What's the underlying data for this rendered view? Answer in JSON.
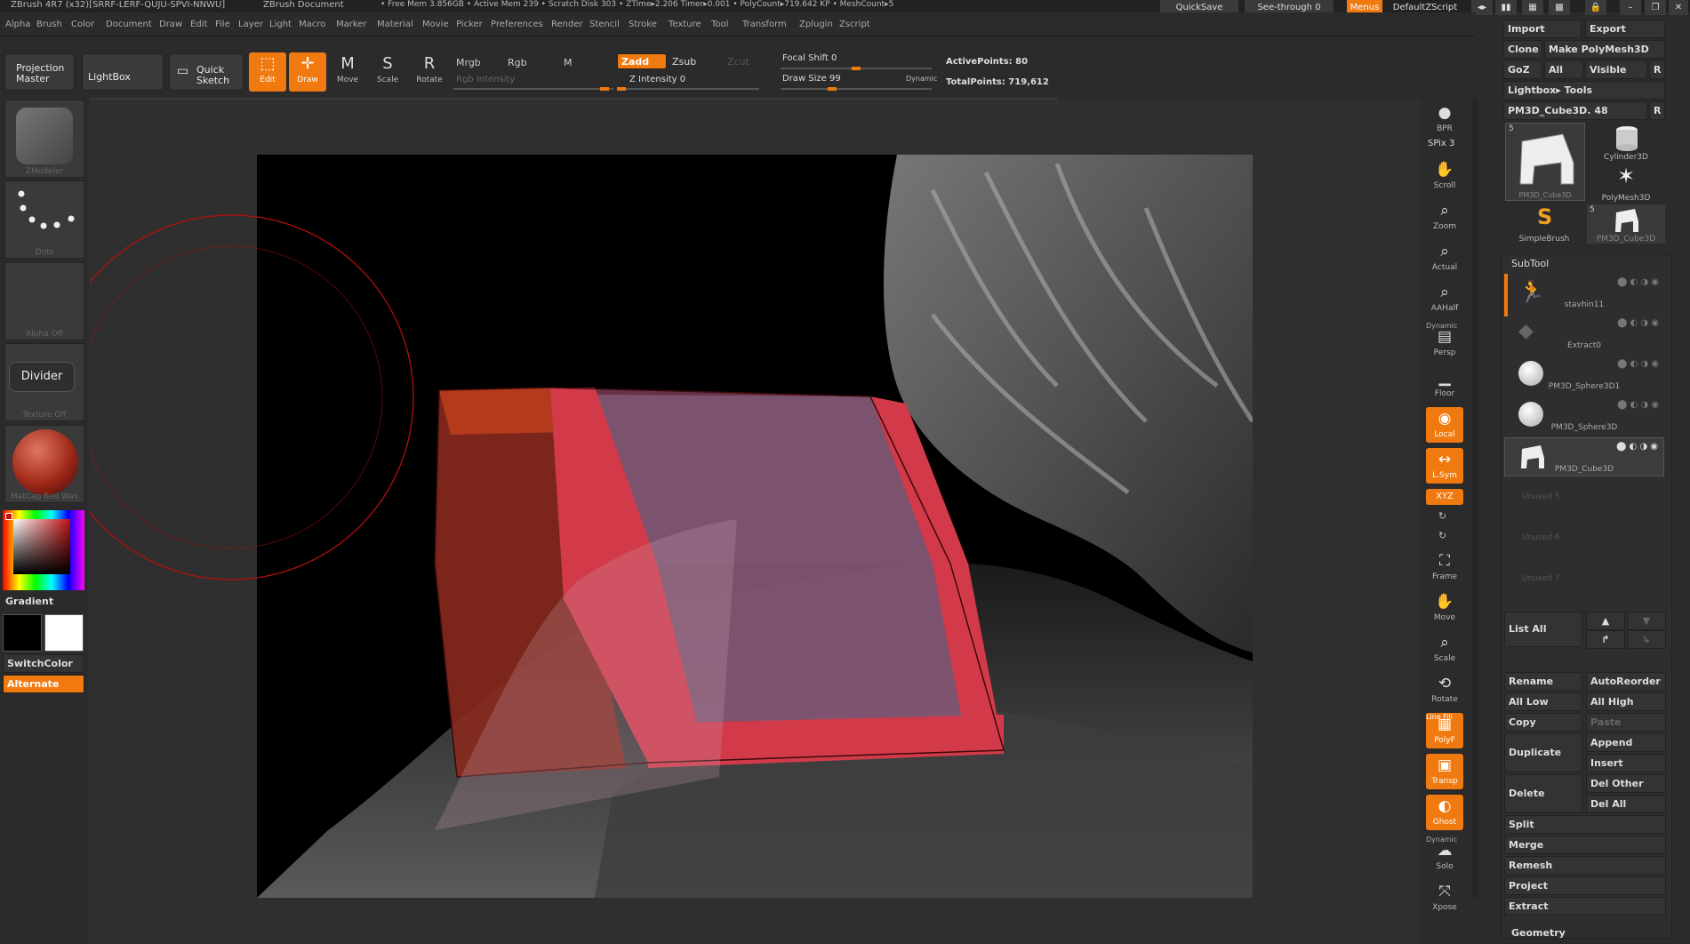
{
  "title_bar": {
    "app": "ZBrush 4R7 (x32)[SRRF-LERF-QUJU-SPVI-NNWU]",
    "document": "ZBrush Document",
    "stats": "• Free Mem 3.856GB • Active Mem 239 • Scratch Disk 303 • ZTime▸2.206 Timer▸0.001 • PolyCount▸719.642 KP • MeshCount▸5",
    "quicksave": "QuickSave",
    "see_through": "See-through",
    "see_through_value": "0",
    "menus": "Menus",
    "default_zscript": "DefaultZScript"
  },
  "menu_items": [
    "Alpha",
    "Brush",
    "Color",
    "Document",
    "Draw",
    "Edit",
    "File",
    "Layer",
    "Light",
    "Macro",
    "Marker",
    "Material",
    "Movie",
    "Picker",
    "Preferences",
    "Render",
    "Stencil",
    "Stroke",
    "Texture",
    "Tool",
    "Transform",
    "Zplugin",
    "Zscript"
  ],
  "toolbar": {
    "projection_master": "Projection Master",
    "lightbox": "LightBox",
    "quick_sketch": "Quick Sketch",
    "edit": "Edit",
    "draw": "Draw",
    "move": "Move",
    "scale": "Scale",
    "rotate": "Rotate",
    "mrgb": "Mrgb",
    "rgb": "Rgb",
    "m": "M",
    "rgb_intensity": "Rgb Intensity",
    "zadd": "Zadd",
    "zsub": "Zsub",
    "zcut": "Zcut",
    "z_intensity": "Z Intensity 0",
    "focal_shift": "Focal Shift 0",
    "draw_size": "Draw Size 99",
    "dynamic": "Dynamic",
    "active_points": "ActivePoints: 80",
    "total_points": "TotalPoints: 719,612"
  },
  "left_shelf": {
    "brush_caption": "ZModeler",
    "stroke_caption": "Dots",
    "alpha_caption": "Alpha Off",
    "divider": "Divider",
    "texture_caption": "Texture Off",
    "material_caption": "MatCap Red Wax",
    "gradient": "Gradient",
    "switch_color": "SwitchColor",
    "alternate": "Alternate"
  },
  "right_tools": [
    "BPR",
    "SPix 3",
    "Scroll",
    "Zoom",
    "Actual",
    "AAHalf",
    "Persp",
    "Floor",
    "Local",
    "L.Sym",
    "XYZ",
    "Frame",
    "Move",
    "Scale",
    "Rotate",
    "PolyF",
    "Transp",
    "Ghost",
    "Solo",
    "Xpose"
  ],
  "right_tools_extra": {
    "dynamic": "Dynamic",
    "line_fill": "Line Fill"
  },
  "tool_panel": {
    "import": "Import",
    "export": "Export",
    "clone": "Clone",
    "make_polymesh": "Make PolyMesh3D",
    "goz": "GoZ",
    "all": "All",
    "visible": "Visible",
    "r": "R",
    "lightbox_tools": "Lightbox▸ Tools",
    "current_tool": "PM3D_Cube3D. 48",
    "thumbs": [
      {
        "label": "PM3D_Cube3D",
        "badge": "5"
      },
      {
        "label": "Cylinder3D",
        "badge": ""
      },
      {
        "label": "PolyMesh3D",
        "badge": ""
      },
      {
        "label": "SimpleBrush",
        "badge": ""
      },
      {
        "label": "PM3D_Cube3D",
        "badge": "5"
      }
    ]
  },
  "subtool": {
    "header": "SubTool",
    "items": [
      "stavhin11",
      "Extract0",
      "PM3D_Sphere3D1",
      "PM3D_Sphere3D",
      "PM3D_Cube3D"
    ],
    "unused": [
      "Unused 5",
      "Unused 6",
      "Unused 7"
    ],
    "list_all": "List All",
    "rename": "Rename",
    "auto_reorder": "AutoReorder",
    "all_low": "All Low",
    "all_high": "All High",
    "copy": "Copy",
    "paste": "Paste",
    "duplicate": "Duplicate",
    "append": "Append",
    "insert": "Insert",
    "delete": "Delete",
    "del_other": "Del Other",
    "del_all": "Del All",
    "split": "Split",
    "merge": "Merge",
    "remesh": "Remesh",
    "project": "Project",
    "extract": "Extract",
    "geometry": "Geometry"
  },
  "colors": {
    "accent": "#f07a10",
    "panel": "#2b2b2b",
    "button": "#3a3a3a"
  }
}
